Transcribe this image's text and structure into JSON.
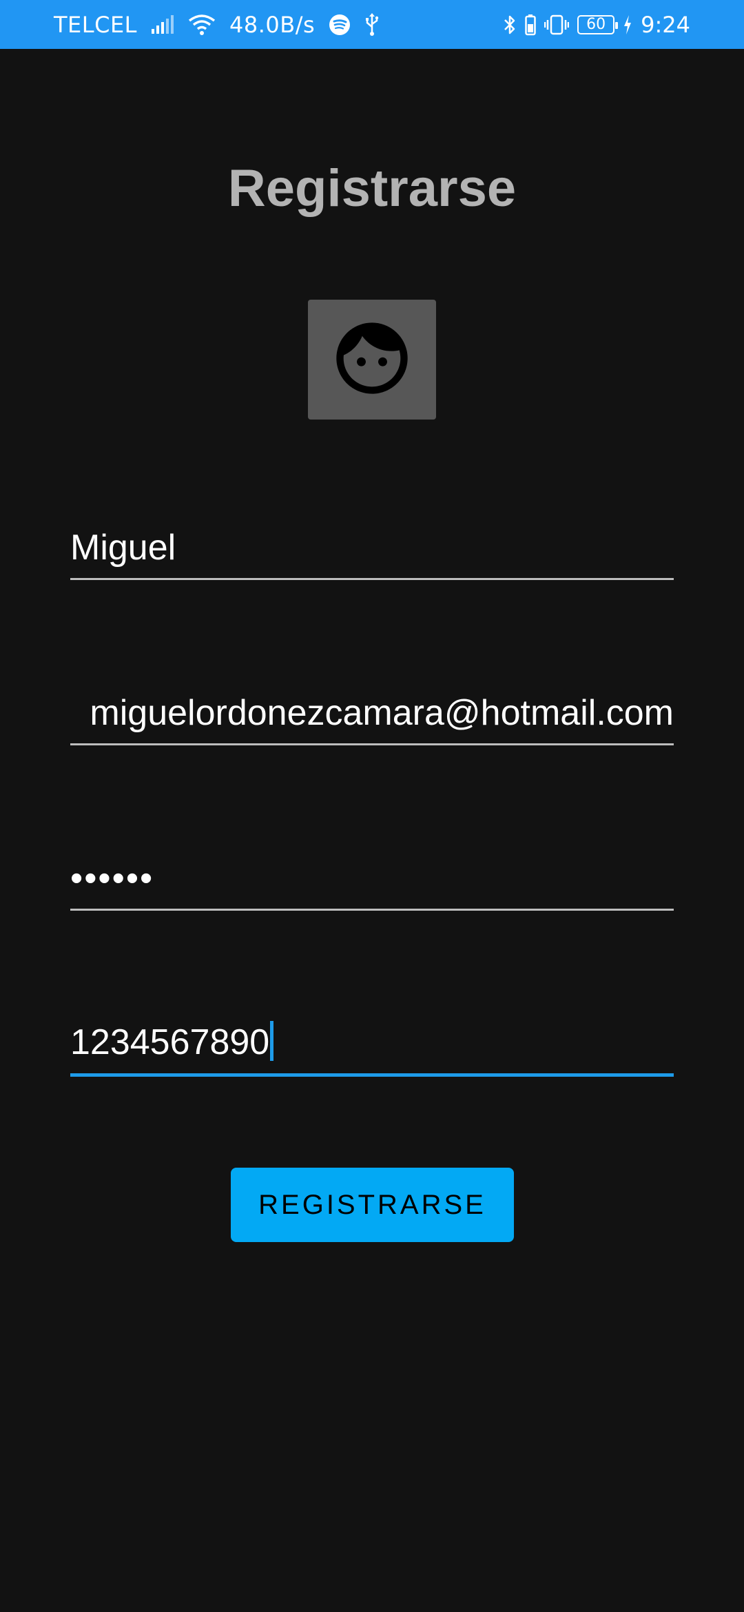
{
  "status_bar": {
    "carrier": "TELCEL",
    "net_speed": "48.0B/s",
    "battery_level": "60",
    "time": "9:24",
    "icons": [
      "signal-icon",
      "wifi-icon",
      "spotify-icon",
      "usb-icon",
      "bluetooth-icon",
      "battery-small-icon",
      "vibrate-icon",
      "battery-icon",
      "charging-icon"
    ]
  },
  "screen": {
    "title": "Registrarse"
  },
  "avatar": {
    "icon": "face-icon"
  },
  "form": {
    "name": "Miguel",
    "email": "miguelordonezcamara@hotmail.com",
    "password_masked": "••••••",
    "phone": "1234567890",
    "focused_field": "phone"
  },
  "button": {
    "label": "REGISTRARSE"
  },
  "colors": {
    "status_bar": "#2196F3",
    "background": "#121212",
    "title": "#B3B3B3",
    "avatar_bg": "#575757",
    "accent": "#1E9BE9",
    "button": "#03A9F4",
    "underline": "#BDBDBD"
  }
}
